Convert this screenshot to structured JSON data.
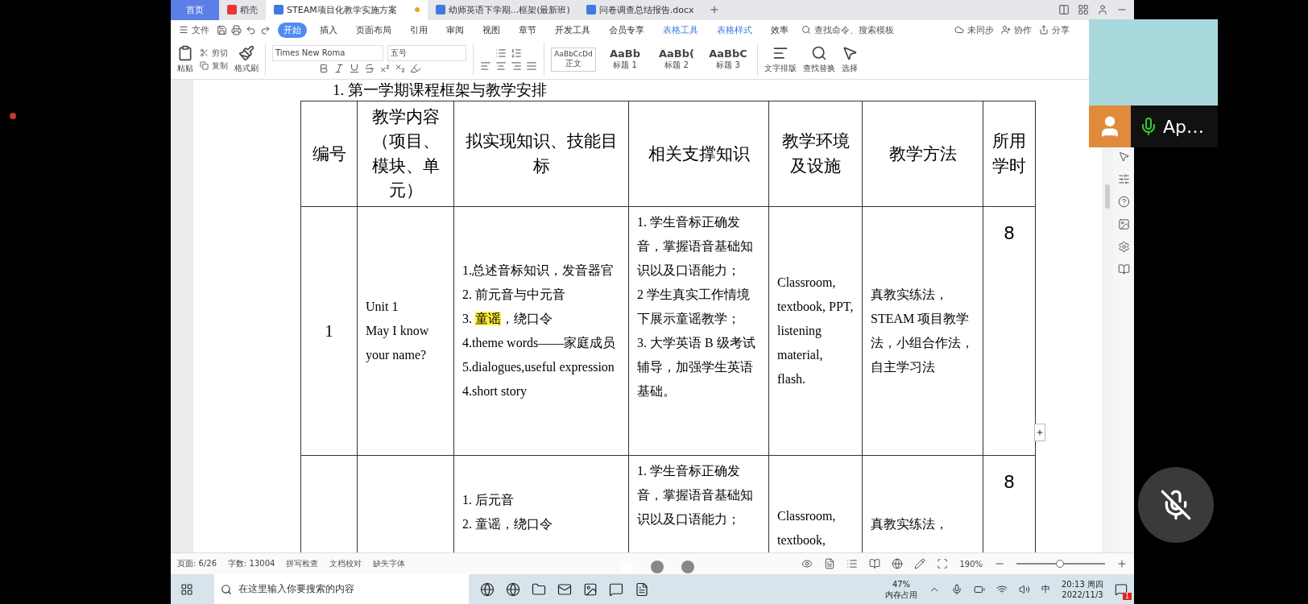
{
  "tabs": [
    {
      "label": "首页",
      "kind": "home",
      "selected": false
    },
    {
      "label": "稻壳",
      "kind": "docer",
      "selected": false
    },
    {
      "label": "STEAM项目化教学实施方案",
      "kind": "doc",
      "selected": true
    },
    {
      "label": "幼师英语下学期...框架(最新班)",
      "kind": "doc",
      "selected": false
    },
    {
      "label": "问卷调查总结报告.docx",
      "kind": "doc",
      "selected": false
    }
  ],
  "menu": {
    "file": "文件",
    "items": [
      {
        "label": "开始",
        "selected": true,
        "kind": "normal"
      },
      {
        "label": "插入",
        "selected": false,
        "kind": "normal"
      },
      {
        "label": "页面布局",
        "selected": false,
        "kind": "normal"
      },
      {
        "label": "引用",
        "selected": false,
        "kind": "normal"
      },
      {
        "label": "审阅",
        "selected": false,
        "kind": "normal"
      },
      {
        "label": "视图",
        "selected": false,
        "kind": "normal"
      },
      {
        "label": "章节",
        "selected": false,
        "kind": "normal"
      },
      {
        "label": "开发工具",
        "selected": false,
        "kind": "normal"
      },
      {
        "label": "会员专享",
        "selected": false,
        "kind": "normal"
      },
      {
        "label": "表格工具",
        "selected": false,
        "kind": "context"
      },
      {
        "label": "表格样式",
        "selected": false,
        "kind": "context"
      },
      {
        "label": "效率",
        "selected": false,
        "kind": "normal"
      }
    ],
    "search_placeholder": "查找命令、搜索模板",
    "sync": "未同步",
    "collab": "协作",
    "share": "分享"
  },
  "ribbon": {
    "paste": "粘贴",
    "cut": "剪切",
    "copy": "复制",
    "format_painter": "格式刷",
    "font": "Times New Roma",
    "size": "五号",
    "styles": [
      {
        "sample": "AaBbCcDd",
        "label": "正文",
        "selected": true
      },
      {
        "sample": "AaBb",
        "label": "标题 1",
        "selected": false
      },
      {
        "sample": "AaBb(",
        "label": "标题 2",
        "selected": false
      },
      {
        "sample": "AaBbC",
        "label": "标题 3",
        "selected": false
      }
    ],
    "text_layout": "文字排版",
    "find_replace": "查找替换",
    "select": "选择"
  },
  "document": {
    "heading": "1. 第一学期课程框架与教学安排",
    "table": {
      "columns": [
        "编号",
        "教学内容（项目、模块、单元）",
        "拟实现知识、技能目标",
        "相关支撑知识",
        "教学环境及设施",
        "教学方法",
        "所用学时"
      ],
      "rows": [
        {
          "number": "1",
          "content": [
            "Unit 1",
            "May I know your name?"
          ],
          "goals": [
            [
              {
                "text": "1.总述音标知识，发音器官",
                "highlight": false
              }
            ],
            [
              {
                "text": "2. 前元音与中元音",
                "highlight": false
              }
            ],
            [
              {
                "text": "3. ",
                "highlight": false
              },
              {
                "text": "童谣",
                "highlight": true
              },
              {
                "text": "，绕口令",
                "highlight": false
              }
            ],
            [
              {
                "text": "4.theme words——家庭成员",
                "highlight": false
              }
            ],
            [
              {
                "text": "5.dialogues,useful expression",
                "highlight": false
              }
            ],
            [
              {
                "text": "4.short story",
                "highlight": false
              }
            ]
          ],
          "support": [
            "1. 学生音标正确发音，掌握语音基础知识以及口语能力；",
            "2 学生真实工作情境下展示童谣教学；",
            "3. 大学英语 B 级考试辅导，加强学生英语基础。"
          ],
          "environment": "Classroom, textbook, PPT, listening material, flash.",
          "method": "真教实练法，STEAM 项目教学法，小组合作法，自主学习法",
          "hours": "8"
        },
        {
          "number": "",
          "content": [],
          "goals": [
            [
              {
                "text": "1. 后元音",
                "highlight": false
              }
            ],
            [
              {
                "text": "2. 童谣，绕口令",
                "highlight": false
              }
            ]
          ],
          "support": [
            "1. 学生音标正确发音，掌握语音基础知识以及口语能力；"
          ],
          "environment": "Classroom, textbook,",
          "method": "真教实练法，",
          "hours": "8"
        }
      ]
    }
  },
  "status_bar": {
    "page": "页面: 6/26",
    "words": "字数: 13004",
    "spell": "拼写检查",
    "proof": "文档校对",
    "missing_font": "缺失字体",
    "zoom": "190%",
    "zoom_level": {
      "level": 0.5
    }
  },
  "pager": [
    {
      "selected": true
    },
    {
      "selected": false
    },
    {
      "selected": false
    }
  ],
  "taskbar": {
    "search_placeholder": "在这里输入你要搜索的内容",
    "memory": "47%",
    "memory_label": "内存占用",
    "ime": "中",
    "time": "20:13 周四",
    "date": "2022/11/3",
    "notifications": "1"
  },
  "video_tile": {
    "name": "Ap…"
  }
}
